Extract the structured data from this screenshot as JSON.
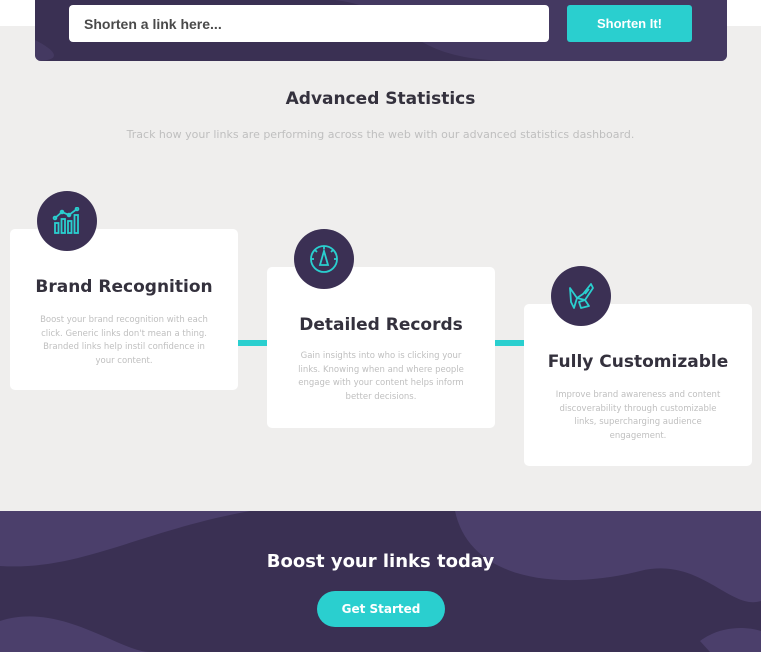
{
  "shorten": {
    "placeholder": "Shorten a link here...",
    "button_label": "Shorten It!"
  },
  "stats": {
    "title": "Advanced Statistics",
    "subtitle": "Track how your links are performing across the web with our advanced statistics dashboard.",
    "cards": [
      {
        "icon": "brand-recognition-icon",
        "title": "Brand Recognition",
        "text": "Boost your brand recognition with each click. Generic links don't mean a thing. Branded links help instil confidence in your content."
      },
      {
        "icon": "detailed-records-icon",
        "title": "Detailed Records",
        "text": "Gain insights into who is clicking your links. Knowing when and where people engage with your content helps inform better decisions."
      },
      {
        "icon": "fully-customizable-icon",
        "title": "Fully Customizable",
        "text": "Improve brand awareness and content discoverability through customizable links, supercharging audience engagement."
      }
    ]
  },
  "boost": {
    "title": "Boost your links today",
    "button_label": "Get Started"
  },
  "colors": {
    "primary_cyan": "#2acfcf",
    "dark_violet": "#3b3054",
    "background": "#efeeed",
    "grayish_text": "#bfbfbf",
    "dark_text": "#34313d"
  }
}
